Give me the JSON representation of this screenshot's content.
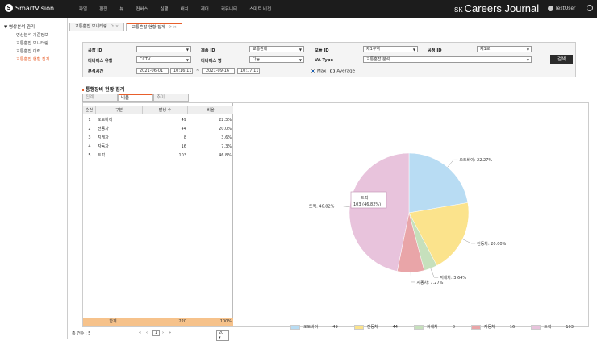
{
  "brand": {
    "logo_text": "SmartVision",
    "journal_sk": "SK",
    "journal_name": "Careers Journal",
    "user": "TestUser"
  },
  "menu": [
    "파일",
    "편집",
    "뷰",
    "컨버스",
    "실행",
    "배치",
    "제어",
    "커뮤니티",
    "스마트 비전"
  ],
  "sidebar": {
    "group": "영상분석 관리",
    "items": [
      {
        "label": "영상분석 기준정보",
        "active": false
      },
      {
        "label": "교통혼잡 모니터링",
        "active": false
      },
      {
        "label": "교통혼잡 이력",
        "active": false
      },
      {
        "label": "교통혼잡 현황 집계",
        "active": true
      }
    ]
  },
  "tabs": [
    {
      "label": "교통혼잡 모니터링"
    },
    {
      "label": "교통혼잡 현황 집계"
    }
  ],
  "filter": {
    "factory_label": "공장 ID",
    "factory_value": "",
    "product_label": "제품 ID",
    "product_value": "교통관제",
    "model_label": "모듈 ID",
    "model_value": "제1구역",
    "plant_label": "공정 ID",
    "plant_value": "제1로",
    "device_type_label": "디바이스 유형",
    "device_type_value": "CCTV",
    "device_name_label": "디바이스 명",
    "device_name_value": "다능",
    "va_type_label": "VA Type",
    "va_type_value": "교통혼잡 분석",
    "period_label": "분석시간",
    "date_from": "2021-06-01",
    "time_from": "10:16:11",
    "tilde": "~",
    "date_to": "2021-09-16",
    "time_to": "10:17:11",
    "radio_max": "Max",
    "radio_avg": "Average",
    "search_label": "검색"
  },
  "section_title": "통행장비 현황 집계",
  "subtabs": [
    {
      "label": "집계"
    },
    {
      "label": "비율"
    },
    {
      "label": "추이"
    }
  ],
  "table": {
    "headers": [
      "순번",
      "구분",
      "발생 수",
      "비율"
    ],
    "rows": [
      {
        "no": "1",
        "name": "오토바이",
        "count": "49",
        "ratio": "22.3%"
      },
      {
        "no": "2",
        "name": "전동차",
        "count": "44",
        "ratio": "20.0%"
      },
      {
        "no": "3",
        "name": "지게차",
        "count": "8",
        "ratio": "3.6%"
      },
      {
        "no": "4",
        "name": "자동차",
        "count": "16",
        "ratio": "7.3%"
      },
      {
        "no": "5",
        "name": "트럭",
        "count": "103",
        "ratio": "46.8%"
      }
    ],
    "sum_label": "합계",
    "sum_count": "220",
    "sum_ratio": "100%"
  },
  "pager": {
    "total": "총 건수 : 5",
    "page": "1",
    "page_size": "20",
    "first": "«",
    "prev": "‹",
    "next": "›",
    "last": "»"
  },
  "chart_data": {
    "type": "pie",
    "slices": [
      {
        "name": "오토바이",
        "value": 49,
        "percent": "22.27%",
        "color": "#b8dcf3"
      },
      {
        "name": "전동차",
        "value": 44,
        "percent": "20.00%",
        "color": "#fbe38c"
      },
      {
        "name": "지게차",
        "value": 8,
        "percent": "3.64%",
        "color": "#c6e0bc"
      },
      {
        "name": "자동차",
        "value": 16,
        "percent": "7.27%",
        "color": "#e9a5a8"
      },
      {
        "name": "트럭",
        "value": 103,
        "percent": "46.82%",
        "color": "#e8c3dc"
      }
    ],
    "tooltip": {
      "title": "트럭",
      "text": "103 (46.82%)"
    },
    "legend_position": "bottom"
  }
}
